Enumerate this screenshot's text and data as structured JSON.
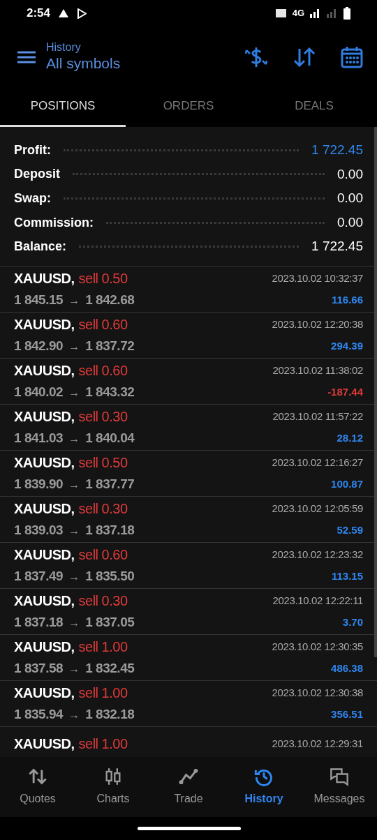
{
  "status_bar": {
    "time": "2:54",
    "network": "4G"
  },
  "header": {
    "subtitle": "History",
    "title": "All symbols"
  },
  "tabs": [
    {
      "label": "POSITIONS",
      "selected": true
    },
    {
      "label": "ORDERS",
      "selected": false
    },
    {
      "label": "DEALS",
      "selected": false
    }
  ],
  "summary": [
    {
      "label": "Profit:",
      "value": "1 722.45",
      "highlight": true
    },
    {
      "label": "Deposit",
      "value": "0.00",
      "highlight": false
    },
    {
      "label": "Swap:",
      "value": "0.00",
      "highlight": false
    },
    {
      "label": "Commission:",
      "value": "0.00",
      "highlight": false
    },
    {
      "label": "Balance:",
      "value": "1 722.45",
      "highlight": false
    }
  ],
  "positions": [
    {
      "symbol": "XAUUSD,",
      "side": "sell 0.50",
      "open": "1 845.15",
      "arrow": "→",
      "close": "1 842.68",
      "time": "2023.10.02 10:32:37",
      "profit": "116.66",
      "loss": false
    },
    {
      "symbol": "XAUUSD,",
      "side": "sell 0.60",
      "open": "1 842.90",
      "arrow": "→",
      "close": "1 837.72",
      "time": "2023.10.02 12:20:38",
      "profit": "294.39",
      "loss": false
    },
    {
      "symbol": "XAUUSD,",
      "side": "sell 0.60",
      "open": "1 840.02",
      "arrow": "→",
      "close": "1 843.32",
      "time": "2023.10.02 11:38:02",
      "profit": "-187.44",
      "loss": true
    },
    {
      "symbol": "XAUUSD,",
      "side": "sell 0.30",
      "open": "1 841.03",
      "arrow": "→",
      "close": "1 840.04",
      "time": "2023.10.02 11:57:22",
      "profit": "28.12",
      "loss": false
    },
    {
      "symbol": "XAUUSD,",
      "side": "sell 0.50",
      "open": "1 839.90",
      "arrow": "→",
      "close": "1 837.77",
      "time": "2023.10.02 12:16:27",
      "profit": "100.87",
      "loss": false
    },
    {
      "symbol": "XAUUSD,",
      "side": "sell 0.30",
      "open": "1 839.03",
      "arrow": "→",
      "close": "1 837.18",
      "time": "2023.10.02 12:05:59",
      "profit": "52.59",
      "loss": false
    },
    {
      "symbol": "XAUUSD,",
      "side": "sell 0.60",
      "open": "1 837.49",
      "arrow": "→",
      "close": "1 835.50",
      "time": "2023.10.02 12:23:32",
      "profit": "113.15",
      "loss": false
    },
    {
      "symbol": "XAUUSD,",
      "side": "sell 0.30",
      "open": "1 837.18",
      "arrow": "→",
      "close": "1 837.05",
      "time": "2023.10.02 12:22:11",
      "profit": "3.70",
      "loss": false
    },
    {
      "symbol": "XAUUSD,",
      "side": "sell 1.00",
      "open": "1 837.58",
      "arrow": "→",
      "close": "1 832.45",
      "time": "2023.10.02 12:30:35",
      "profit": "486.38",
      "loss": false
    },
    {
      "symbol": "XAUUSD,",
      "side": "sell 1.00",
      "open": "1 835.94",
      "arrow": "→",
      "close": "1 832.18",
      "time": "2023.10.02 12:30:38",
      "profit": "356.51",
      "loss": false
    },
    {
      "symbol": "XAUUSD,",
      "side": "sell 1.00",
      "time": "2023.10.02 12:29:31"
    }
  ],
  "bottom_nav": [
    {
      "label": "Quotes",
      "kind": "quotes",
      "selected": false
    },
    {
      "label": "Charts",
      "kind": "charts",
      "selected": false
    },
    {
      "label": "Trade",
      "kind": "trade",
      "selected": false
    },
    {
      "label": "History",
      "kind": "history",
      "selected": true
    },
    {
      "label": "Messages",
      "kind": "messages",
      "selected": false
    }
  ]
}
